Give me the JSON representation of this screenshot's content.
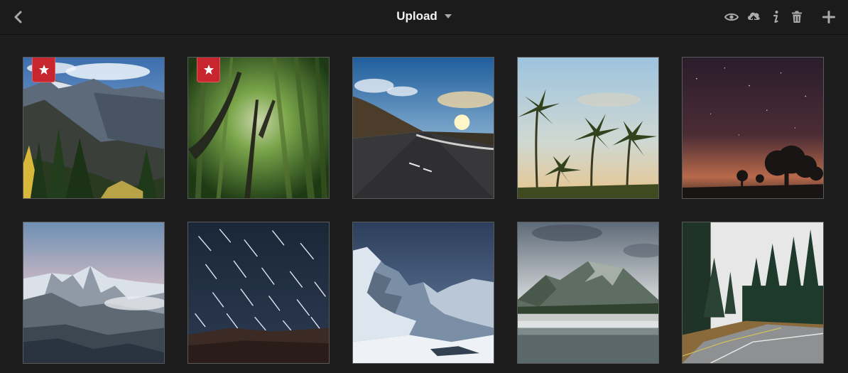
{
  "topbar": {
    "title": "Upload",
    "back_icon": "chevron-left-icon",
    "dropdown_icon": "caret-down-icon",
    "tools": [
      "eye-icon",
      "cloud-upload-icon",
      "info-icon",
      "trash-icon",
      "plus-icon"
    ]
  },
  "colors": {
    "background": "#1d1d1d",
    "topbar": "#1b1b1b",
    "favorite_badge": "#c8262f",
    "tile_border": "#5a5a5a"
  },
  "photos": [
    {
      "subject": "mountain-valley-hikers",
      "favorite": true
    },
    {
      "subject": "bamboo-forest",
      "favorite": true
    },
    {
      "subject": "mountain-road-sunset",
      "favorite": false
    },
    {
      "subject": "palm-trees-sky",
      "favorite": false
    },
    {
      "subject": "night-sky-silhouette-trees",
      "favorite": false
    },
    {
      "subject": "snowy-peak-pink-sky",
      "favorite": false
    },
    {
      "subject": "star-trails",
      "favorite": false
    },
    {
      "subject": "snowy-alpine-ridge",
      "favorite": false
    },
    {
      "subject": "misty-mountain-lake",
      "favorite": false
    },
    {
      "subject": "forest-road-fog",
      "favorite": false
    }
  ]
}
